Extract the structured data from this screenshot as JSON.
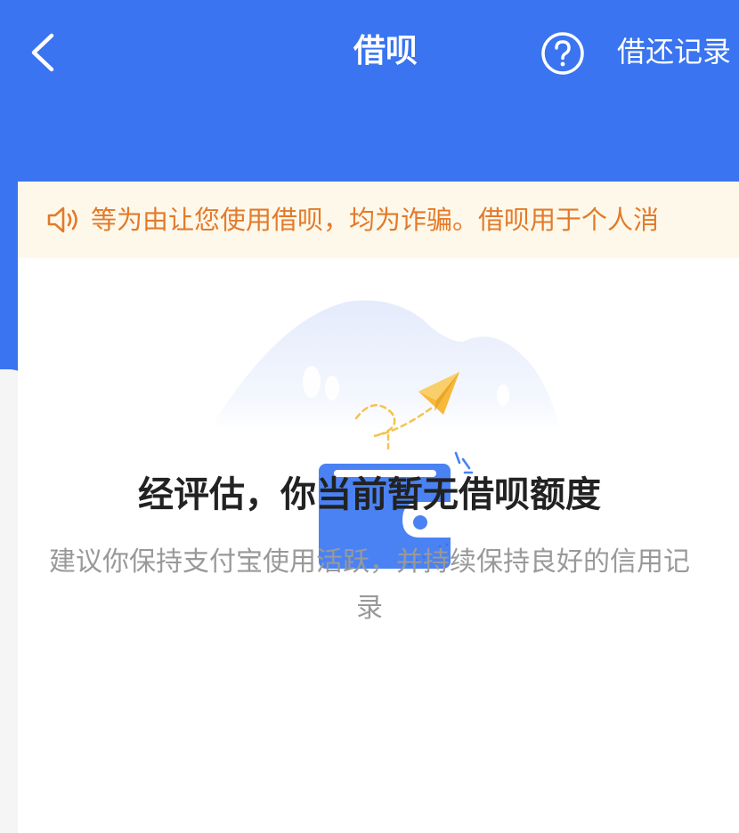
{
  "nav": {
    "back_icon": "chevron-left-icon",
    "title": "借呗",
    "help_icon": "question-circle-icon",
    "history_label": "借还记录"
  },
  "notice": {
    "icon": "speaker-icon",
    "text": "等为由让您使用借呗，均为诈骗。借呗用于个人消"
  },
  "empty_state": {
    "illustration": "wallet-with-paper-plane",
    "title": "经评估，你当前暂无借呗额度",
    "description": "建议你保持支付宝使用活跃，并持续保持良好的信用记录"
  },
  "colors": {
    "primary_blue": "#3a74f0",
    "notice_bg": "#fef8ea",
    "notice_text": "#e37a2a",
    "wallet_blue": "#4a82f4",
    "plane_yellow": "#f6b93a"
  }
}
